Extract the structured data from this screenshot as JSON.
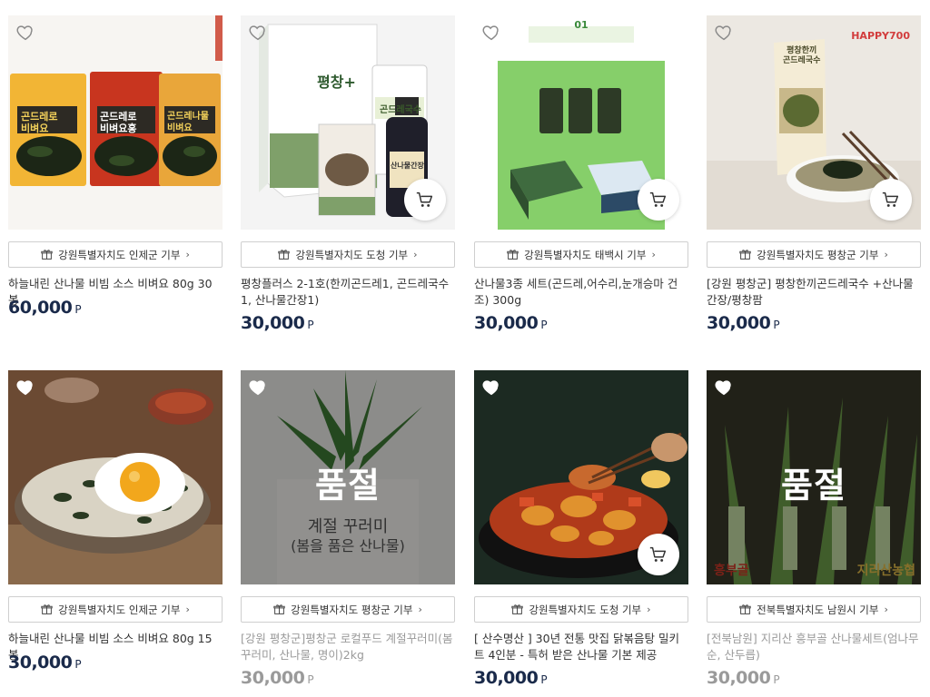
{
  "products": [
    {
      "donation": "강원특별자치도 인제군 기부",
      "title": "하늘내린 산나물 비빔 소스 비벼요 80g 30봉",
      "price": "60,000",
      "unit": "P",
      "soldout": false,
      "cart": false,
      "label_a": "곤드레로\n비벼요",
      "label_b": "곤드레로\n비벼요홍",
      "label_c": "곤드레나물\n비벼요"
    },
    {
      "donation": "강원특별자치도 도청 기부",
      "title": "평창플러스 2-1호(한끼곤드레1, 곤드레국수1, 산나물간장1)",
      "price": "30,000",
      "unit": "P",
      "soldout": false,
      "cart": true,
      "box_text": "평창+",
      "jar_text": "곤드레국수",
      "bottle_text": "산나물간장"
    },
    {
      "donation": "강원특별자치도 태백시 기부",
      "title": "산나물3종 세트(곤드레,어수리,눈개승마 건조) 300g",
      "price": "30,000",
      "unit": "P",
      "soldout": false,
      "cart": true,
      "poster_head": "01"
    },
    {
      "donation": "강원특별자치도 평창군 기부",
      "title": "[강원 평창군] 평창한끼곤드레국수 +산나물간장/평창팜",
      "price": "30,000",
      "unit": "P",
      "soldout": false,
      "cart": true,
      "brand": "HAPPY700",
      "pack_text": "평창한끼\n곤드레국수"
    },
    {
      "donation": "강원특별자치도 인제군 기부",
      "title": "하늘내린 산나물 비빔 소스 비벼요 80g 15봉",
      "price": "30,000",
      "unit": "P",
      "soldout": false,
      "cart": false
    },
    {
      "donation": "강원특별자치도 평창군 기부",
      "title": "[강원 평창군]평창군 로컬푸드 계절꾸러미(봄꾸러미, 산나물, 명이)2kg",
      "price": "30,000",
      "unit": "P",
      "soldout": true,
      "cart": false,
      "soldout_label": "품절",
      "box_line1": "계절 꾸러미",
      "box_line2": "(봄을 품은 산나물)"
    },
    {
      "donation": "강원특별자치도 도청 기부",
      "title": "[ 산수명산 ] 30년 전통 맛집 닭볶음탕 밀키트 4인분 - 특허 받은 산나물 기본 제공",
      "price": "30,000",
      "unit": "P",
      "soldout": false,
      "cart": true
    },
    {
      "donation": "전북특별자치도 남원시 기부",
      "title": "[전북남원] 지리산 흥부골 산나물세트(엄나무순, 산두릅)",
      "price": "30,000",
      "unit": "P",
      "soldout": true,
      "cart": false,
      "soldout_label": "품절",
      "logo_left": "흥부골",
      "logo_right": "지리산농협"
    }
  ]
}
